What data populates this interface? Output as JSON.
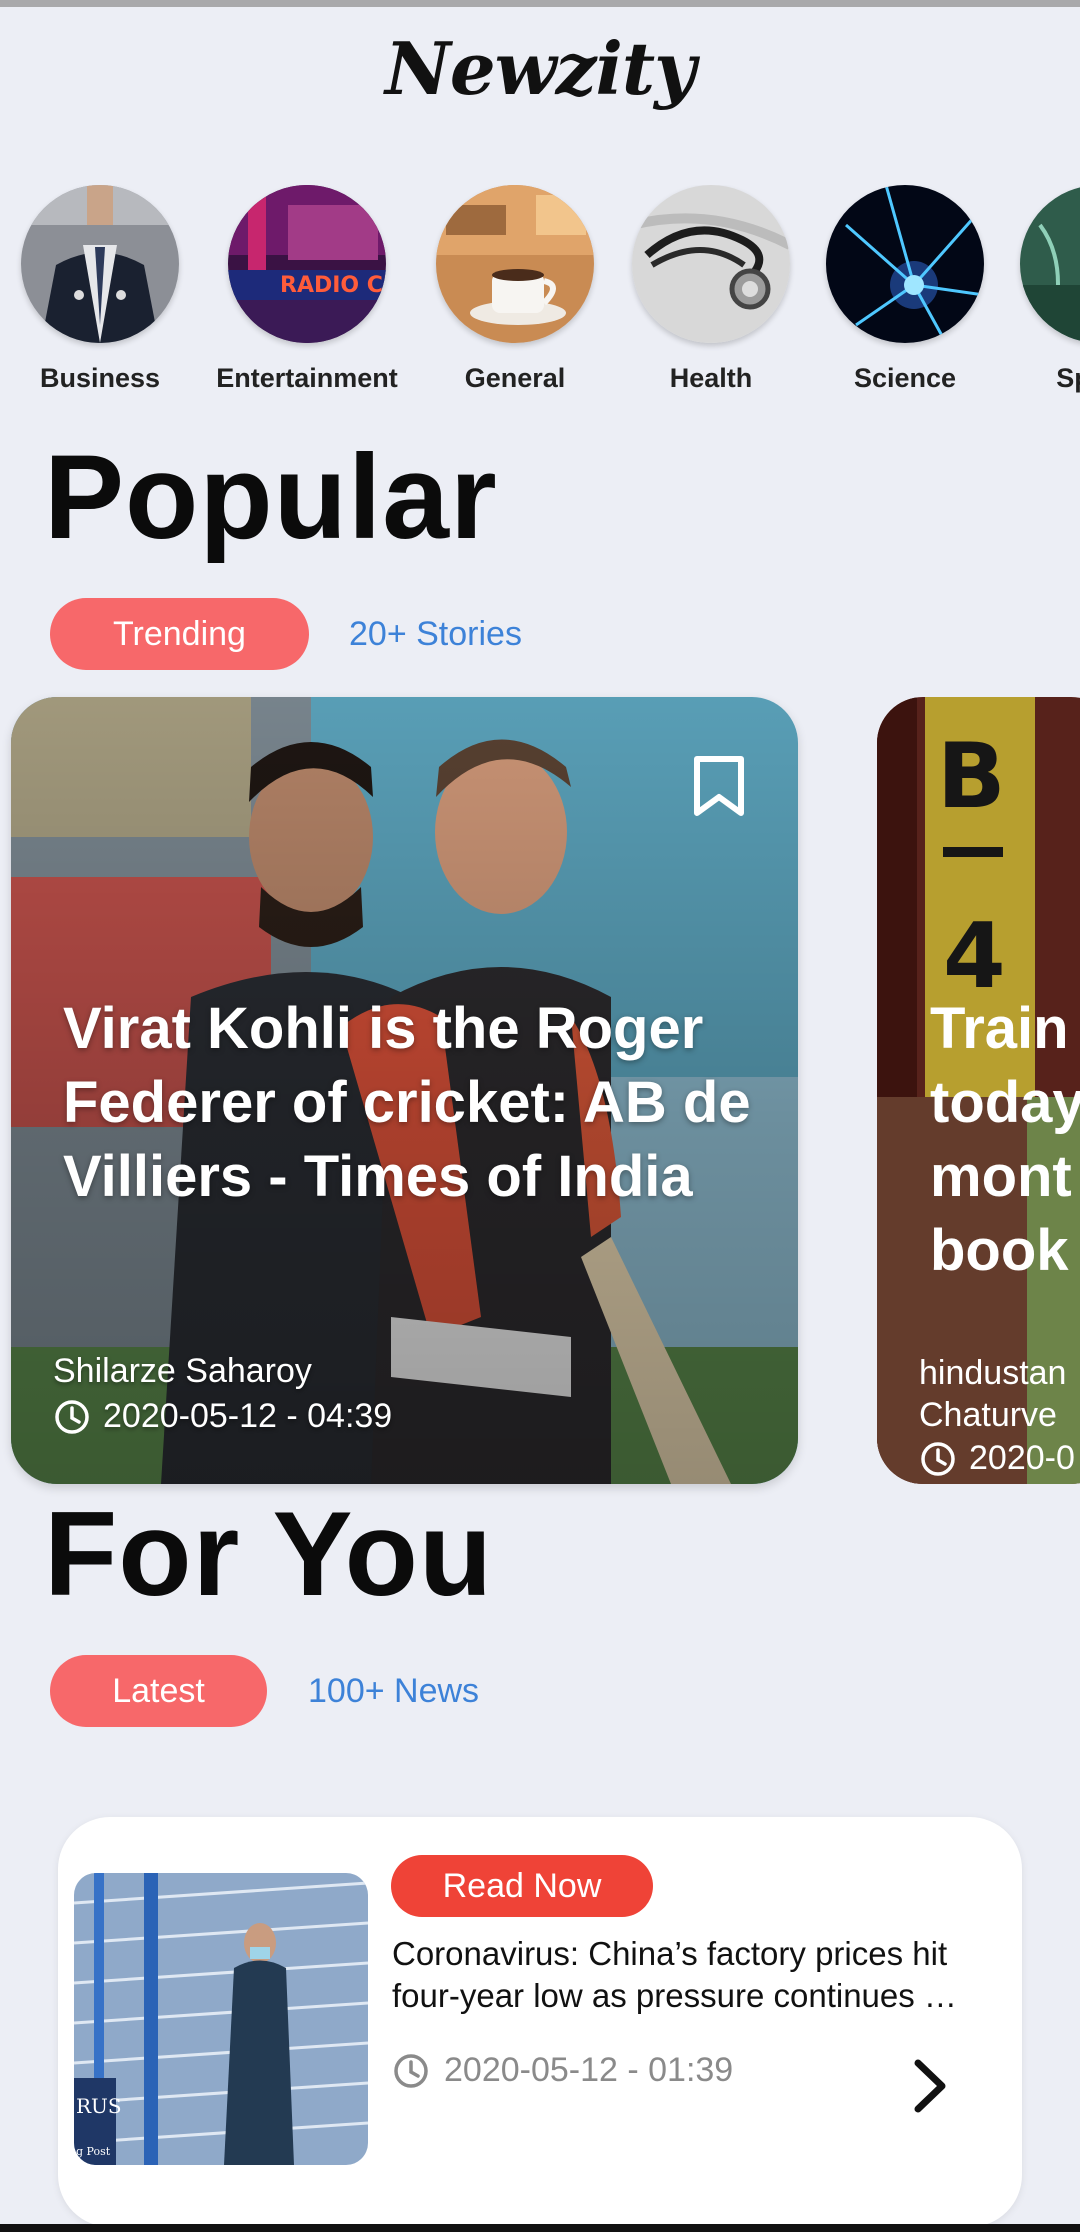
{
  "app": {
    "logo": "Newzity"
  },
  "categories": [
    {
      "label": "Business",
      "icon": "business-person-photo"
    },
    {
      "label": "Entertainment",
      "icon": "radio-city-photo"
    },
    {
      "label": "General",
      "icon": "coffee-cup-photo"
    },
    {
      "label": "Health",
      "icon": "stethoscope-photo"
    },
    {
      "label": "Science",
      "icon": "plasma-ball-photo"
    },
    {
      "label": "Sports",
      "icon": "sports-photo"
    }
  ],
  "popular": {
    "title": "Popular",
    "pill": "Trending",
    "count": "20+ Stories",
    "cards": [
      {
        "title": "Virat Kohli is the Roger Federer of cricket: AB de Villiers - Times of India",
        "author": "Shilarze Saharoy",
        "time": "2020-05-12 - 04:39"
      },
      {
        "title_lines": [
          "Train",
          "today",
          "mont",
          "book"
        ],
        "author_lines": [
          "hindustan",
          "Chaturve"
        ],
        "time": "2020-0"
      }
    ]
  },
  "for_you": {
    "title": "For You",
    "pill": "Latest",
    "count": "100+ News",
    "items": [
      {
        "action": "Read Now",
        "title": "Coronavirus: China’s factory prices hit four-year low as pressure continues …",
        "time": "2020-05-12 - 01:39",
        "thumb_text_1": "RUS",
        "thumb_text_2": "g Post"
      }
    ]
  },
  "colors": {
    "background": "#eceef5",
    "accent_pill": "#f7686a",
    "read_now": "#ef4337",
    "link": "#3d82d8"
  }
}
